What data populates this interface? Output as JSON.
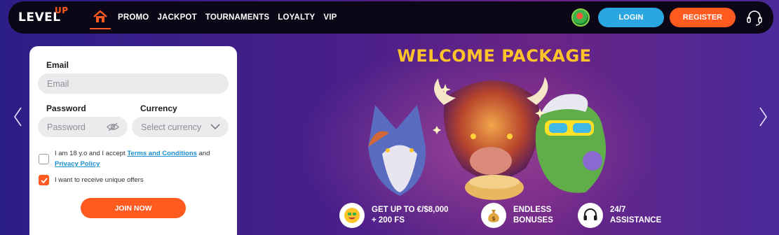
{
  "nav": {
    "logo_main": "LEVEL",
    "logo_sup": "UP",
    "links": [
      "PROMO",
      "JACKPOT",
      "TOURNAMENTS",
      "LOYALTY",
      "VIP"
    ],
    "login_label": "LOGIN",
    "register_label": "REGISTER"
  },
  "form": {
    "email_label": "Email",
    "email_placeholder": "Email",
    "password_label": "Password",
    "password_placeholder": "Password",
    "currency_label": "Currency",
    "currency_placeholder": "Select currency",
    "age_text_before": "I am 18 y.o and I accept",
    "terms_link": "Terms and Conditions",
    "age_text_and": "and",
    "privacy_link": "Privacy Policy",
    "age_checked": false,
    "offers_text": "I want to receive unique offers",
    "offers_checked": true,
    "join_label": "JOIN NOW"
  },
  "promo": {
    "title": "WELCOME PACKAGE",
    "features": [
      {
        "icon": "money-face-icon",
        "text": "GET UP TO €/$8,000\n+ 200 FS"
      },
      {
        "icon": "money-bag-icon",
        "text": "ENDLESS\nBONUSES"
      },
      {
        "icon": "headset-icon",
        "text": "24/7\nASSISTANCE"
      }
    ]
  },
  "colors": {
    "accent": "#ff5a1f",
    "login": "#2aa6e0",
    "title": "#ffc42a",
    "link": "#1b8fd0"
  }
}
